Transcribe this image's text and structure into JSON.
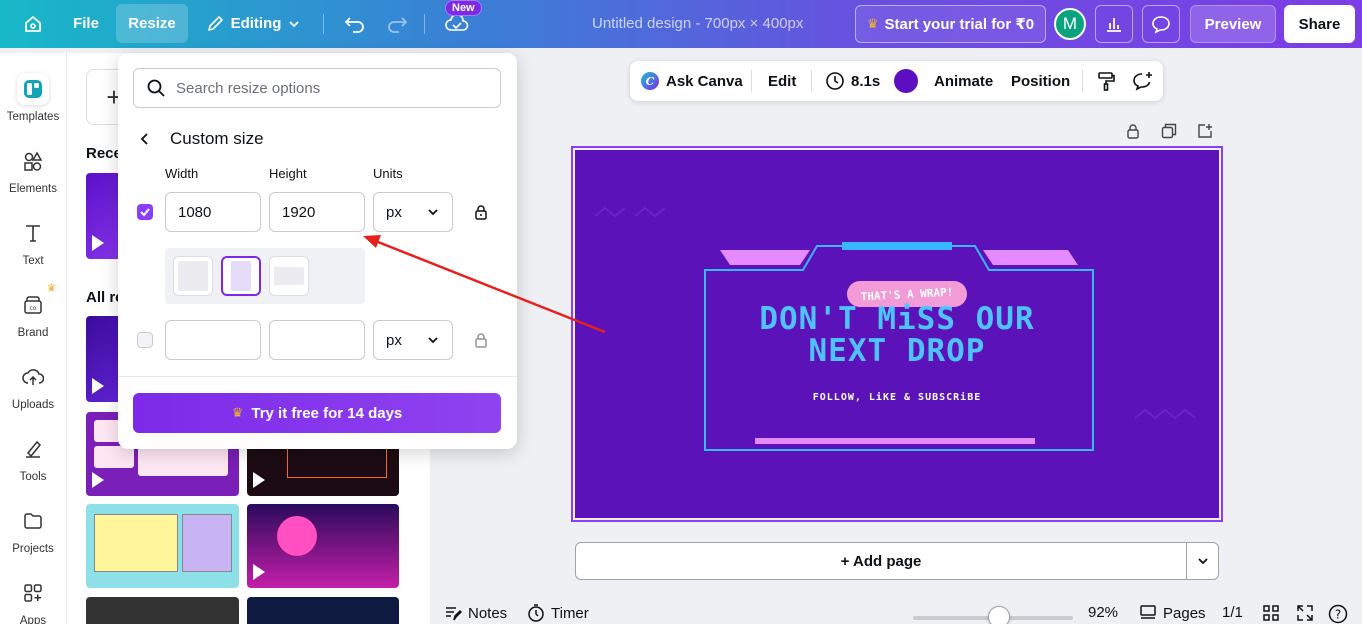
{
  "topbar": {
    "file_label": "File",
    "resize_label": "Resize",
    "editing_label": "Editing",
    "new_badge": "New",
    "design_title": "Untitled design - 700px × 400px",
    "trial_label": "Start your trial for ₹0",
    "avatar_initial": "M",
    "preview_label": "Preview",
    "share_label": "Share"
  },
  "rail": {
    "items": [
      {
        "label": "Templates"
      },
      {
        "label": "Elements"
      },
      {
        "label": "Text"
      },
      {
        "label": "Brand"
      },
      {
        "label": "Uploads"
      },
      {
        "label": "Tools"
      },
      {
        "label": "Projects"
      },
      {
        "label": "Apps"
      }
    ]
  },
  "panel": {
    "recent_heading": "Rece",
    "all_heading": "All re"
  },
  "resize_popover": {
    "search_placeholder": "Search resize options",
    "title": "Custom size",
    "width_label": "Width",
    "height_label": "Height",
    "units_label": "Units",
    "width_value": "1080",
    "height_value": "1920",
    "unit_value": "px",
    "unit_value_2": "px",
    "try_label": "Try it free for 14 days"
  },
  "context_toolbar": {
    "ask_label": "Ask Canva",
    "edit_label": "Edit",
    "duration": "8.1s",
    "animate_label": "Animate",
    "position_label": "Position",
    "color": "#5b0fc0"
  },
  "design": {
    "tag": "THAT'S A WRAP!",
    "headline_1": "DON'T MiSS OUR",
    "headline_2": "NEXT DROP",
    "subline": "FOLLOW, LiKE & SUBSCRiBE"
  },
  "canvas_footer": {
    "add_page_label": "+ Add page"
  },
  "bottom": {
    "notes_label": "Notes",
    "timer_label": "Timer",
    "zoom": "92%",
    "pages_label": "Pages",
    "page_count": "1/1",
    "zoom_fraction": 0.54
  },
  "colors": {
    "accent": "#8b3dff",
    "canvas_bg": "#5b12b8",
    "neon_blue": "#38b6ff",
    "neon_pink": "#e58bff",
    "arrow": "#e8201c"
  }
}
